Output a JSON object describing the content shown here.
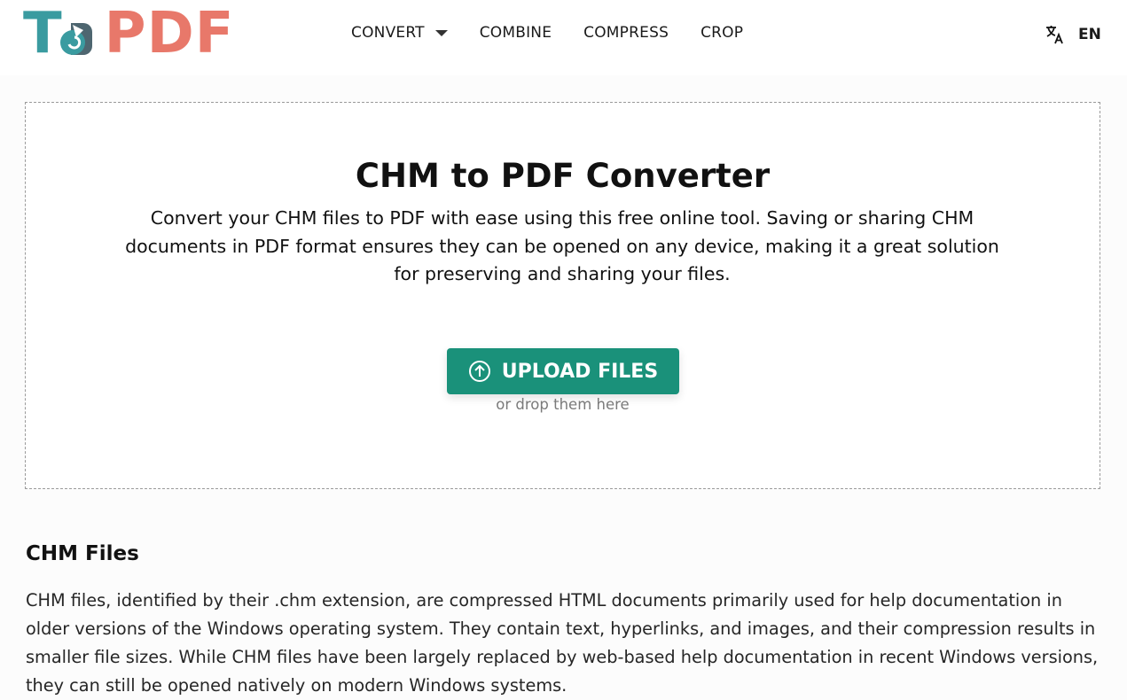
{
  "header": {
    "logo": {
      "prefix": "T",
      "suffix": "PDF",
      "alt": "ToPDF"
    },
    "nav": [
      {
        "label": "CONVERT",
        "has_dropdown": true
      },
      {
        "label": "COMBINE",
        "has_dropdown": false
      },
      {
        "label": "COMPRESS",
        "has_dropdown": false
      },
      {
        "label": "CROP",
        "has_dropdown": false
      }
    ],
    "language": {
      "icon": "translate-icon",
      "label": "EN"
    }
  },
  "hero": {
    "title": "CHM to PDF Converter",
    "description": "Convert your CHM files to PDF with ease using this free online tool. Saving or sharing CHM documents in PDF format ensures they can be opened on any device, making it a great solution for preserving and sharing your files.",
    "upload_button": {
      "label": "UPLOAD FILES",
      "icon": "upload-icon"
    },
    "drop_hint": "or drop them here"
  },
  "section": {
    "title": "CHM Files",
    "body": "CHM files, identified by their .chm extension, are compressed HTML documents primarily used for help documentation in older versions of the Windows operating system. They contain text, hyperlinks, and images, and their compression results in smaller file sizes. While CHM files have been largely replaced by web-based help documentation in recent Windows versions, they can still be opened natively on modern Windows systems."
  },
  "colors": {
    "logo_teal": "#3a9ba0",
    "logo_coral": "#e8786a",
    "accent_green": "#1a917a"
  }
}
